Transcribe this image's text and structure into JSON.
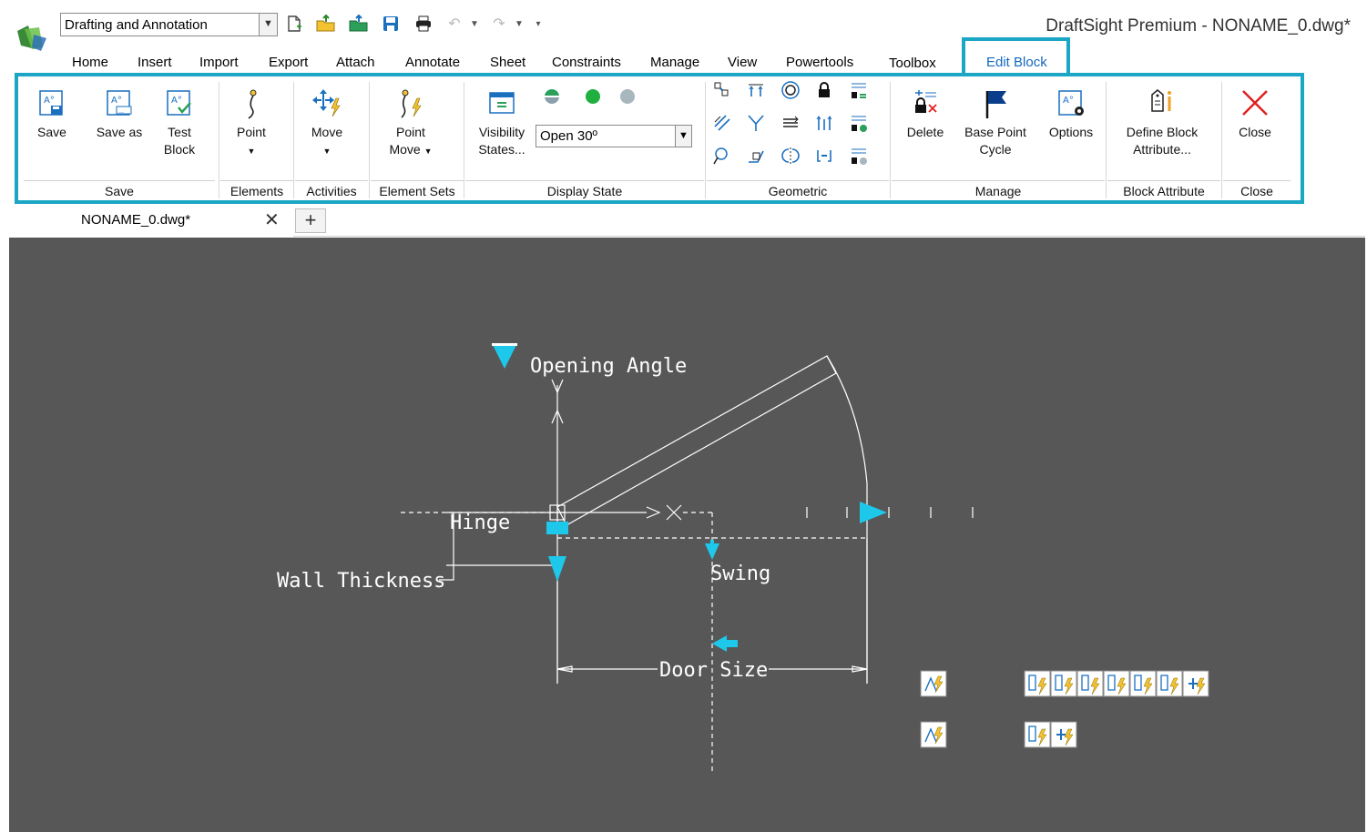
{
  "window": {
    "title": "DraftSight Premium - NONAME_0.dwg*",
    "workspace": "Drafting and Annotation"
  },
  "quick_access": [
    {
      "icon": "new-file-icon"
    },
    {
      "icon": "open-folder-icon"
    },
    {
      "icon": "open-sheet-icon"
    },
    {
      "icon": "save-icon"
    },
    {
      "icon": "print-icon"
    },
    {
      "icon": "undo-icon"
    },
    {
      "icon": "redo-icon"
    },
    {
      "icon": "customize-icon"
    }
  ],
  "ribbon_tabs": [
    "Home",
    "Insert",
    "Import",
    "Export",
    "Attach",
    "Annotate",
    "Sheet",
    "Constraints",
    "Manage",
    "View",
    "Powertools",
    "Toolbox",
    "Edit Block"
  ],
  "active_tab": "Edit Block",
  "accent_color": "#1aa6c4",
  "ribbon": {
    "save_group": {
      "label": "Save",
      "save": "Save",
      "save_as": "Save as",
      "test_block": [
        "Test",
        "Block"
      ]
    },
    "elements_group": {
      "label": "Elements",
      "point": "Point"
    },
    "activities_group": {
      "label": "Activities",
      "move": "Move"
    },
    "element_sets_group": {
      "label": "Element Sets",
      "point_move": [
        "Point",
        "Move"
      ]
    },
    "display_state_group": {
      "label": "Display State",
      "visibility_states": [
        "Visibility",
        "States..."
      ],
      "current_state": "Open 30º"
    },
    "geometric_group": {
      "label": "Geometric"
    },
    "manage_group": {
      "label": "Manage",
      "delete": "Delete",
      "base_point_cycle": [
        "Base Point",
        "Cycle"
      ],
      "options": "Options"
    },
    "block_attribute_group": {
      "label": "Block Attribute",
      "define_block_attribute": [
        "Define Block",
        "Attribute..."
      ]
    },
    "close_group": {
      "label": "Close",
      "close": "Close"
    }
  },
  "document_tab": {
    "name": "NONAME_0.dwg*"
  },
  "drawing": {
    "labels": {
      "opening_angle": "Opening Angle",
      "hinge": "Hinge",
      "wall_thickness": "Wall Thickness",
      "swing": "Swing",
      "door_size": "Door Size"
    },
    "grip_color": "#1ec8ea",
    "line_color": "#ffffff",
    "background": "#575757"
  }
}
